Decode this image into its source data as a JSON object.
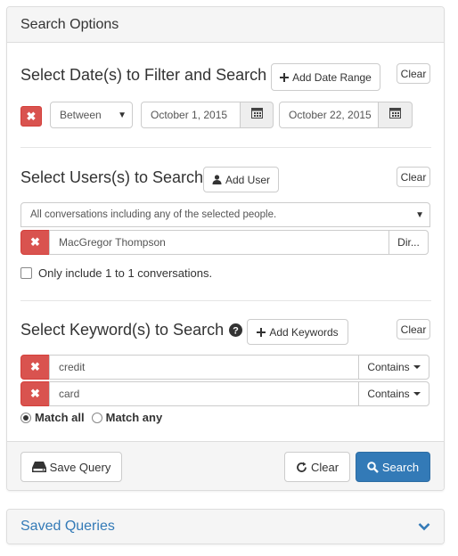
{
  "panel": {
    "title": "Search Options"
  },
  "dates": {
    "title": "Select Date(s) to Filter and Search",
    "add_label": "Add Date Range",
    "clear_label": "Clear",
    "operator": "Between",
    "start_date": "October 1, 2015",
    "end_date": "October 22, 2015"
  },
  "users": {
    "title": "Select Users(s) to Search",
    "add_label": "Add User",
    "clear_label": "Clear",
    "mode": "All conversations including any of the selected people.",
    "items": [
      {
        "name": "MacGregor Thompson",
        "dir_label": "Dir..."
      }
    ],
    "one_to_one_label": "Only include 1 to 1 conversations.",
    "one_to_one_checked": false
  },
  "keywords": {
    "title": "Select Keyword(s) to Search",
    "add_label": "Add Keywords",
    "clear_label": "Clear",
    "items": [
      {
        "term": "credit",
        "match_label": "Contains"
      },
      {
        "term": "card",
        "match_label": "Contains"
      }
    ],
    "match_all_label": "Match all",
    "match_any_label": "Match any",
    "selected": "all"
  },
  "footer": {
    "save_label": "Save Query",
    "clear_label": "Clear",
    "search_label": "Search"
  },
  "saved": {
    "title": "Saved Queries"
  },
  "colors": {
    "danger": "#d9534f",
    "primary": "#337ab7",
    "link": "#337ab7"
  }
}
